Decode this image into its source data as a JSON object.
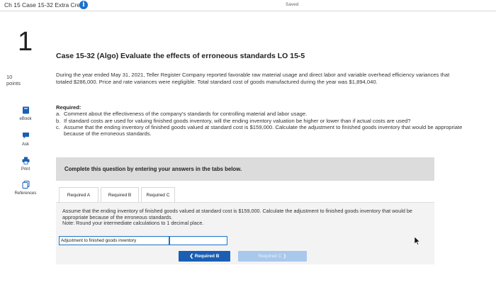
{
  "header": {
    "title": "Ch 15 Case 15-32 Extra Credit",
    "info_icon": "i",
    "saved": "Saved"
  },
  "question": {
    "number": "1",
    "points_value": "10",
    "points_label": "points"
  },
  "sidebar": {
    "ebook": "eBook",
    "ask": "Ask",
    "print": "Print",
    "references": "References"
  },
  "case": {
    "title": "Case 15-32 (Algo) Evaluate the effects of erroneous standards LO 15-5",
    "intro": "During the year ended May 31, 2021, Teller Register Company reported favorable raw material usage and direct labor and variable overhead efficiency variances that totaled $286,000. Price and rate variances were negligible. Total standard cost of goods manufactured during the year was $1,894,040.",
    "required_heading": "Required:",
    "items": [
      {
        "label": "a.",
        "text": "Comment about the effectiveness of the company's standards for controlling material and labor usage."
      },
      {
        "label": "b.",
        "text": "If standard costs are used for valuing finished goods inventory, will the ending inventory valuation be higher or lower than if actual costs are used?"
      },
      {
        "label": "c.",
        "text": "Assume that the ending inventory of finished goods valued at standard cost is $159,000. Calculate the adjustment to finished goods inventory that would be appropriate because of the erroneous standards."
      }
    ]
  },
  "instructions": "Complete this question by entering your answers in the tabs below.",
  "tabs": [
    {
      "label": "Required A"
    },
    {
      "label": "Required B"
    },
    {
      "label": "Required C"
    }
  ],
  "panel": {
    "text": "Assume that the ending inventory of finished goods valued at standard cost is $159,000. Calculate the adjustment to finished goods inventory that would be appropriate because of the erroneous standards.",
    "note": "Note: Round your intermediate calculations to 1 decimal place.",
    "row_label": "Adjustment to finished goods inventory",
    "row_value": ""
  },
  "nav": {
    "prev_label": "Required B",
    "next_label": "Required C"
  },
  "colors": {
    "accent": "#1a5fb4",
    "accent_light": "#a8c8ec",
    "panel_bg": "#f3f3f3",
    "instr_bg": "#dcdcdc"
  }
}
